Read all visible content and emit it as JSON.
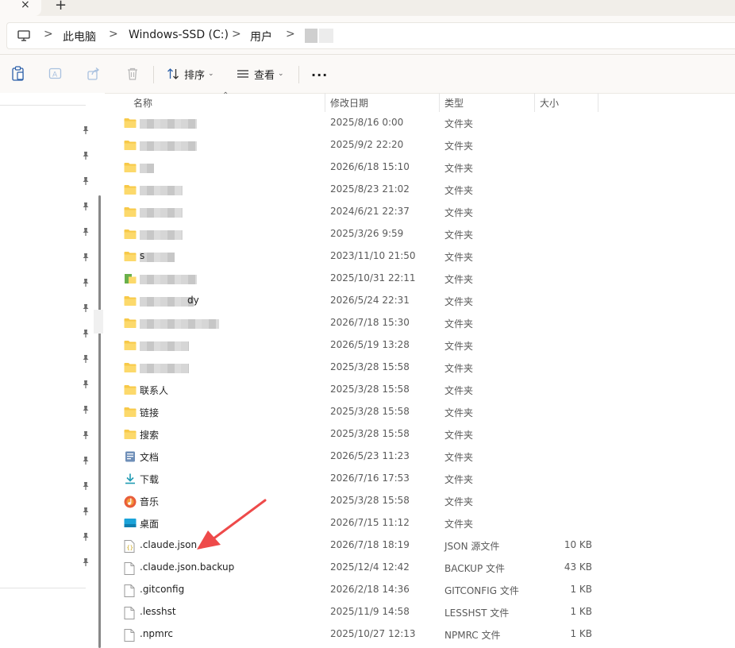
{
  "tabbar": {
    "close_glyph": "×",
    "new_tab_glyph": "+"
  },
  "address": {
    "crumbs": [
      "此电脑",
      "Windows-SSD (C:)",
      "用户"
    ],
    "separator": ">"
  },
  "toolbar": {
    "sort_label": "排序",
    "view_label": "查看",
    "more_label": "..."
  },
  "columns": {
    "name": "名称",
    "date": "修改日期",
    "type": "类型",
    "size": "大小"
  },
  "rows": [
    {
      "name": "",
      "date": "2025/8/16 0:00",
      "type": "文件夹",
      "size": "",
      "icon": "folder-icon"
    },
    {
      "name": "",
      "date": "2025/9/2 22:20",
      "type": "文件夹",
      "size": "",
      "icon": "folder-icon"
    },
    {
      "name": "",
      "date": "2026/6/18 15:10",
      "type": "文件夹",
      "size": "",
      "icon": "folder-icon"
    },
    {
      "name": "",
      "date": "2025/8/23 21:02",
      "type": "文件夹",
      "size": "",
      "icon": "folder-icon"
    },
    {
      "name": "",
      "date": "2024/6/21 22:37",
      "type": "文件夹",
      "size": "",
      "icon": "folder-icon"
    },
    {
      "name": "",
      "date": "2025/3/26 9:59",
      "type": "文件夹",
      "size": "",
      "icon": "folder-icon"
    },
    {
      "name": "s",
      "date": "2023/11/10 21:50",
      "type": "文件夹",
      "size": "",
      "icon": "folder-icon"
    },
    {
      "name": "",
      "date": "2025/10/31 22:11",
      "type": "文件夹",
      "size": "",
      "icon": "folder-green-icon"
    },
    {
      "name": "dy",
      "date": "2026/5/24 22:31",
      "type": "文件夹",
      "size": "",
      "icon": "folder-icon"
    },
    {
      "name": "",
      "date": "2026/7/18 15:30",
      "type": "文件夹",
      "size": "",
      "icon": "folder-icon"
    },
    {
      "name": "",
      "date": "2026/5/19 13:28",
      "type": "文件夹",
      "size": "",
      "icon": "folder-icon"
    },
    {
      "name": "",
      "date": "2025/3/28 15:58",
      "type": "文件夹",
      "size": "",
      "icon": "folder-icon"
    },
    {
      "name": "联系人",
      "date": "2025/3/28 15:58",
      "type": "文件夹",
      "size": "",
      "icon": "folder-icon"
    },
    {
      "name": "链接",
      "date": "2025/3/28 15:58",
      "type": "文件夹",
      "size": "",
      "icon": "folder-icon"
    },
    {
      "name": "搜索",
      "date": "2025/3/28 15:58",
      "type": "文件夹",
      "size": "",
      "icon": "folder-icon"
    },
    {
      "name": "文档",
      "date": "2026/5/23 11:23",
      "type": "文件夹",
      "size": "",
      "icon": "documents-icon"
    },
    {
      "name": "下载",
      "date": "2026/7/16 17:53",
      "type": "文件夹",
      "size": "",
      "icon": "download-icon"
    },
    {
      "name": "音乐",
      "date": "2025/3/28 15:58",
      "type": "文件夹",
      "size": "",
      "icon": "music-icon"
    },
    {
      "name": "桌面",
      "date": "2026/7/15 11:12",
      "type": "文件夹",
      "size": "",
      "icon": "desktop-icon"
    },
    {
      "name": ".claude.json",
      "date": "2026/7/18 18:19",
      "type": "JSON 源文件",
      "size": "10 KB",
      "icon": "json-file-icon"
    },
    {
      "name": ".claude.json.backup",
      "date": "2025/12/4 12:42",
      "type": "BACKUP 文件",
      "size": "43 KB",
      "icon": "file-icon"
    },
    {
      "name": ".gitconfig",
      "date": "2026/2/18 14:36",
      "type": "GITCONFIG 文件",
      "size": "1 KB",
      "icon": "file-icon"
    },
    {
      "name": ".lesshst",
      "date": "2025/11/9 14:58",
      "type": "LESSHST 文件",
      "size": "1 KB",
      "icon": "file-icon"
    },
    {
      "name": ".npmrc",
      "date": "2025/10/27 12:13",
      "type": "NPMRC 文件",
      "size": "1 KB",
      "icon": "file-icon"
    }
  ],
  "colors": {
    "folder": "#f7c948",
    "arrow": "#ee4a4a",
    "accent": "#0067c0"
  }
}
